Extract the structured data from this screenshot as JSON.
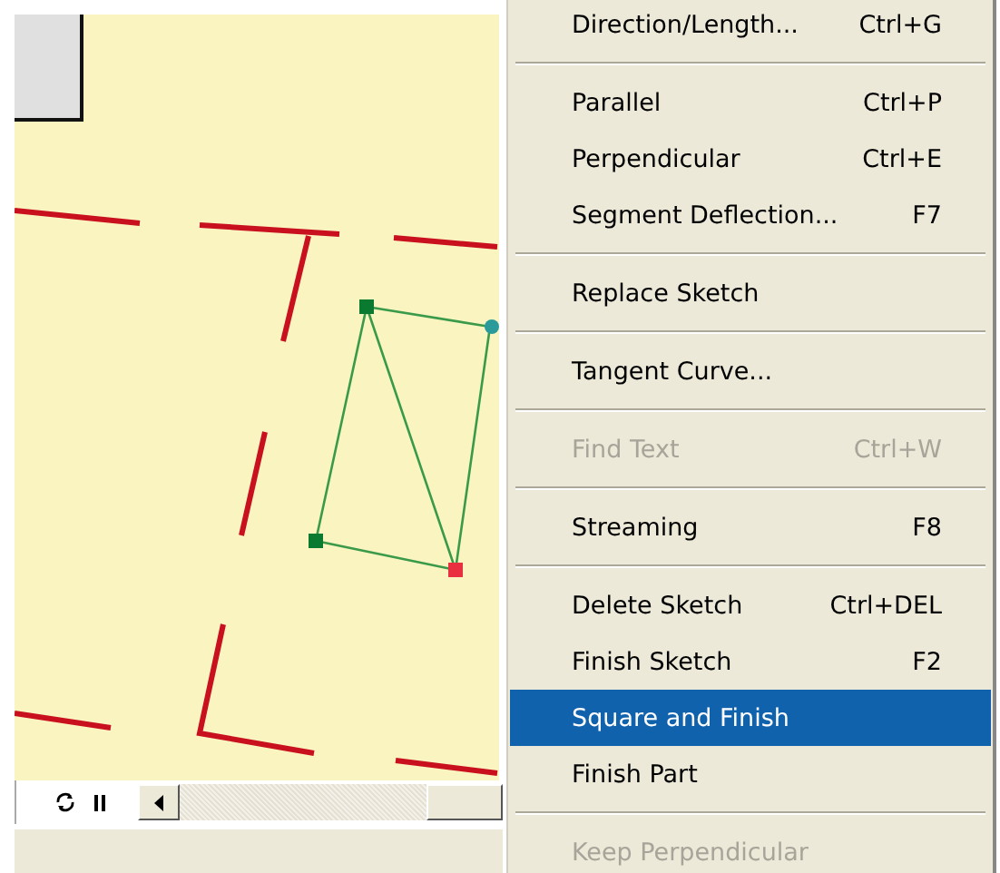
{
  "menu": {
    "items": [
      {
        "kind": "item",
        "label": "Direction/Length...",
        "shortcut": "Ctrl+G",
        "disabled": false,
        "selected": false
      },
      {
        "kind": "separator"
      },
      {
        "kind": "item",
        "label": "Parallel",
        "shortcut": "Ctrl+P",
        "disabled": false,
        "selected": false
      },
      {
        "kind": "item",
        "label": "Perpendicular",
        "shortcut": "Ctrl+E",
        "disabled": false,
        "selected": false
      },
      {
        "kind": "item",
        "label": "Segment Deflection...",
        "shortcut": "F7",
        "disabled": false,
        "selected": false
      },
      {
        "kind": "separator"
      },
      {
        "kind": "item",
        "label": "Replace Sketch",
        "disabled": false,
        "selected": false
      },
      {
        "kind": "separator"
      },
      {
        "kind": "item",
        "label": "Tangent Curve...",
        "disabled": false,
        "selected": false
      },
      {
        "kind": "separator"
      },
      {
        "kind": "item",
        "label": "Find Text",
        "shortcut": "Ctrl+W",
        "disabled": true,
        "selected": false
      },
      {
        "kind": "separator"
      },
      {
        "kind": "item",
        "label": "Streaming",
        "shortcut": "F8",
        "disabled": false,
        "selected": false
      },
      {
        "kind": "separator"
      },
      {
        "kind": "item",
        "label": "Delete Sketch",
        "shortcut": "Ctrl+DEL",
        "disabled": false,
        "selected": false
      },
      {
        "kind": "item",
        "label": "Finish Sketch",
        "shortcut": "F2",
        "disabled": false,
        "selected": false
      },
      {
        "kind": "item",
        "label": "Square and Finish",
        "disabled": false,
        "selected": true
      },
      {
        "kind": "item",
        "label": "Finish Part",
        "disabled": false,
        "selected": false
      },
      {
        "kind": "separator"
      },
      {
        "kind": "item",
        "label": "Keep Perpendicular",
        "disabled": true,
        "selected": false
      }
    ]
  }
}
